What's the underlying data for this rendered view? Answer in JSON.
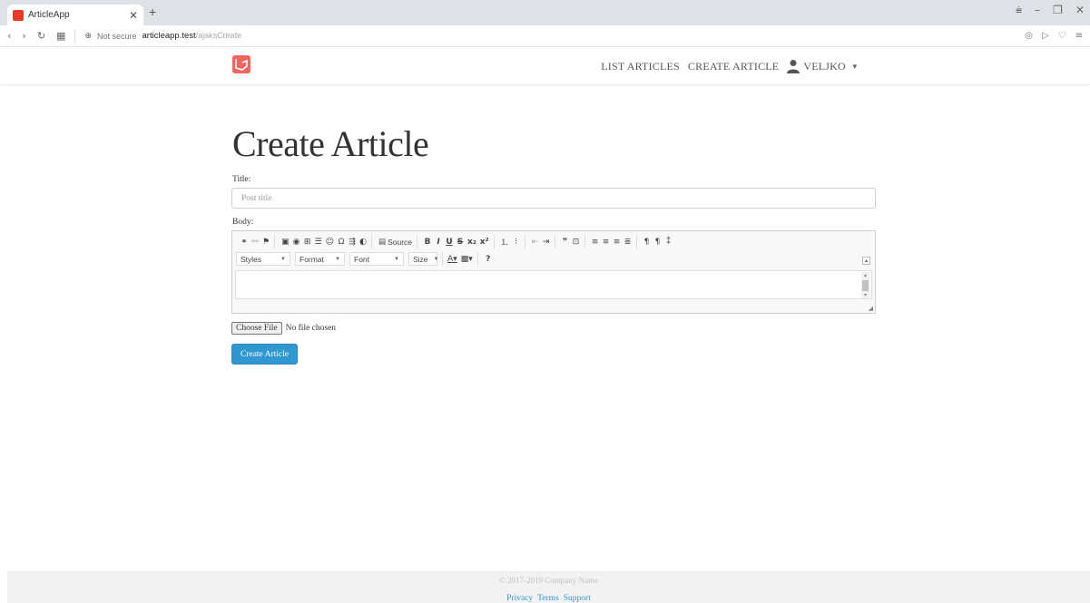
{
  "browser": {
    "tab_title": "ArticleApp",
    "tab_close": "✕",
    "new_tab": "+",
    "not_secure": "Not secure",
    "url_host": "articleapp.test",
    "url_path": "/ajaksCreate"
  },
  "nav": {
    "list_articles": "LIST ARTICLES",
    "create_article": "CREATE ARTICLE",
    "user_name": "VELJKO"
  },
  "page": {
    "title": "Create Article",
    "title_label": "Title:",
    "title_placeholder": "Post title",
    "body_label": "Body:"
  },
  "editor": {
    "source_label": "Source",
    "styles": "Styles",
    "format": "Format",
    "font": "Font",
    "size": "Size"
  },
  "file": {
    "button": "Choose File",
    "status": "No file chosen"
  },
  "submit_label": "Create Article",
  "footer": {
    "copyright": "© 2017-2019 Company Name",
    "links": [
      "Privacy",
      "Terms",
      "Support"
    ]
  },
  "colors": {
    "accent": "#3097d1",
    "logo": "#f4645f"
  }
}
